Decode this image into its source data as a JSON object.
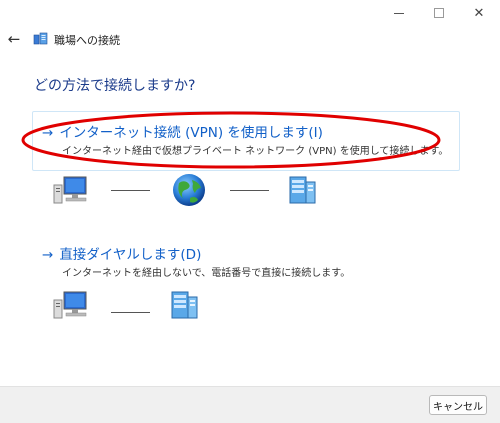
{
  "window": {
    "title": "職場への接続"
  },
  "question": "どの方法で接続しますか?",
  "options": [
    {
      "title": "インターネット接続 (VPN) を使用します(I)",
      "description": "インターネット経由で仮想プライベート ネットワーク (VPN) を使用して接続します。"
    },
    {
      "title": "直接ダイヤルします(D)",
      "description": "インターネットを経由しないで、電話番号で直接に接続します。"
    }
  ],
  "arrow_glyph": "→",
  "back_glyph": "←",
  "close_glyph": "✕",
  "footer": {
    "cancel_label": "キャンセル"
  },
  "colors": {
    "link": "#1260c8",
    "heading": "#1a3a8a",
    "highlight": "#e00000"
  }
}
